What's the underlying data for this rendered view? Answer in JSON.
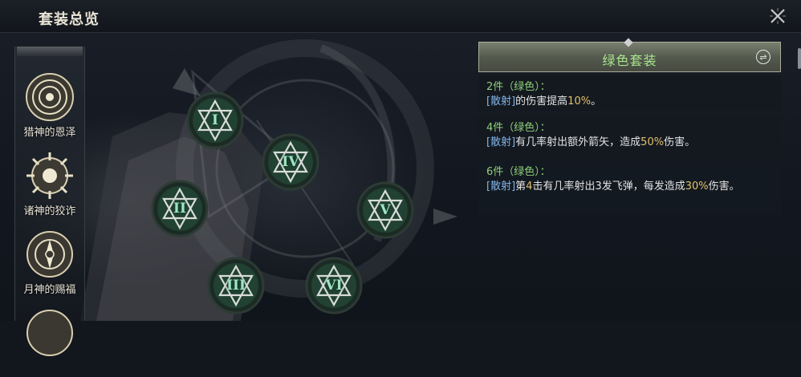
{
  "window": {
    "title": "套装总览",
    "close_icon": "close-icon"
  },
  "sidebar": {
    "items": [
      {
        "label": "猎神的恩泽",
        "icon": "spiral-emblem-icon"
      },
      {
        "label": "诸神的狡诈",
        "icon": "sun-emblem-icon"
      },
      {
        "label": "月神的赐福",
        "icon": "moon-emblem-icon"
      },
      {
        "label": "",
        "icon": "emblem-icon"
      }
    ]
  },
  "slots": [
    "I",
    "IV",
    "II",
    "V",
    "III",
    "VI"
  ],
  "set_panel": {
    "title": "绿色套装",
    "title_color": "#a7e48e",
    "bonuses": [
      {
        "count": "2件（绿色）：",
        "keyword": "[散射]",
        "text_before": "的伤害提高",
        "value": "10%",
        "text_after": "。"
      },
      {
        "count": "4件（绿色）：",
        "keyword": "[散射]",
        "text_before": "有几率射出额外箭矢，造成",
        "value": "50%",
        "text_after": "伤害。"
      },
      {
        "count": "6件（绿色）：",
        "keyword": "[散射]",
        "text_before": "第",
        "value": "4",
        "text_mid": "击有几率射出3发飞弹，每发造成",
        "value2": "30%",
        "text_after": "伤害。"
      }
    ]
  },
  "colors": {
    "keyword": "#7fb4e8",
    "value": "#e3c16b",
    "count": "#8fd07a"
  }
}
